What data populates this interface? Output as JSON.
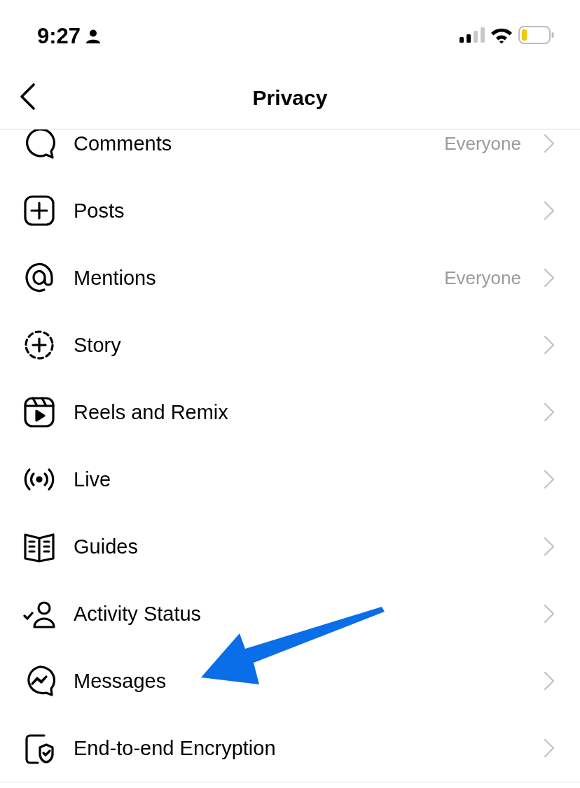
{
  "status_bar": {
    "time": "9:27"
  },
  "header": {
    "title": "Privacy"
  },
  "rows": [
    {
      "label": "Comments",
      "value": "Everyone"
    },
    {
      "label": "Posts"
    },
    {
      "label": "Mentions",
      "value": "Everyone"
    },
    {
      "label": "Story"
    },
    {
      "label": "Reels and Remix"
    },
    {
      "label": "Live"
    },
    {
      "label": "Guides"
    },
    {
      "label": "Activity Status"
    },
    {
      "label": "Messages"
    },
    {
      "label": "End-to-end Encryption"
    }
  ]
}
